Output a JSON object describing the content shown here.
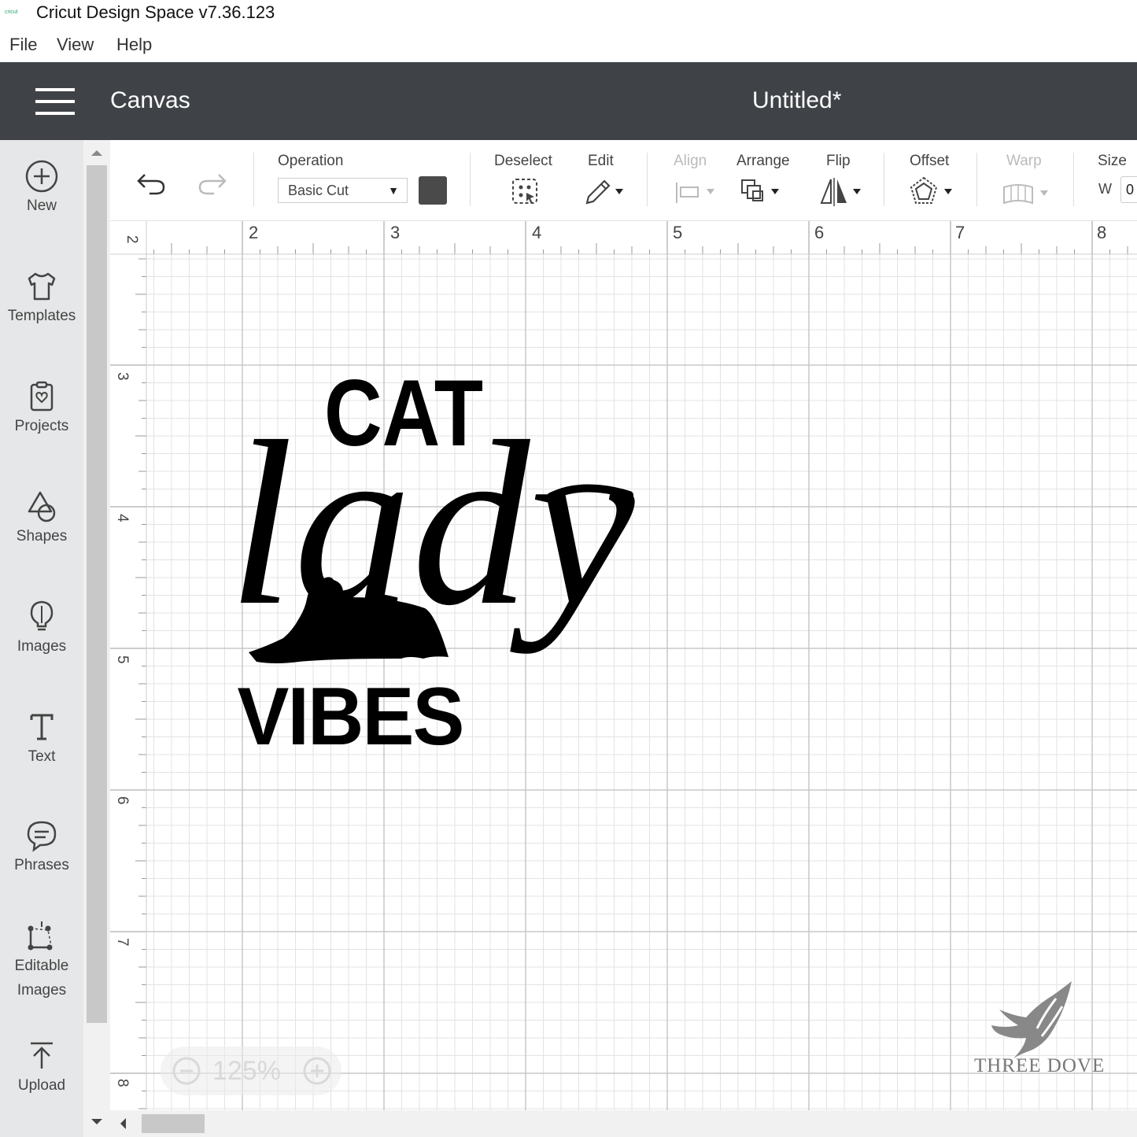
{
  "window": {
    "logo_text": "cricut",
    "title": "Cricut Design Space  v7.36.123"
  },
  "menu": {
    "file": "File",
    "view": "View",
    "help": "Help"
  },
  "header": {
    "section": "Canvas",
    "document_title": "Untitled*"
  },
  "sidebar": {
    "items": [
      {
        "label": "New",
        "icon": "plus-circle-icon"
      },
      {
        "label": "Templates",
        "icon": "tshirt-icon"
      },
      {
        "label": "Projects",
        "icon": "projects-icon"
      },
      {
        "label": "Shapes",
        "icon": "shapes-icon"
      },
      {
        "label": "Images",
        "icon": "lightbulb-icon"
      },
      {
        "label": "Text",
        "icon": "text-t-icon"
      },
      {
        "label": "Phrases",
        "icon": "speech-bubble-icon"
      },
      {
        "label": "Editable",
        "label2": "Images",
        "icon": "editable-images-icon"
      },
      {
        "label": "Upload",
        "icon": "upload-icon"
      }
    ]
  },
  "toolbar": {
    "operation_label": "Operation",
    "operation_value": "Basic Cut",
    "operation_color": "#4a4a4a",
    "deselect": "Deselect",
    "edit": "Edit",
    "align": "Align",
    "arrange": "Arrange",
    "flip": "Flip",
    "offset": "Offset",
    "warp": "Warp",
    "size": "Size",
    "size_w": "W",
    "size_w_value": "0"
  },
  "rulers": {
    "horizontal": [
      "2",
      "2",
      "3",
      "4",
      "5",
      "6",
      "7",
      "8"
    ],
    "vertical": [
      "3",
      "4",
      "5",
      "6",
      "7",
      "8"
    ]
  },
  "design": {
    "line1": "CAT",
    "line2": "lady",
    "line3": "VIBES"
  },
  "zoom": {
    "minus": "−",
    "value": "125%",
    "plus": "+"
  },
  "watermark": {
    "text": "THREE DOVE"
  }
}
